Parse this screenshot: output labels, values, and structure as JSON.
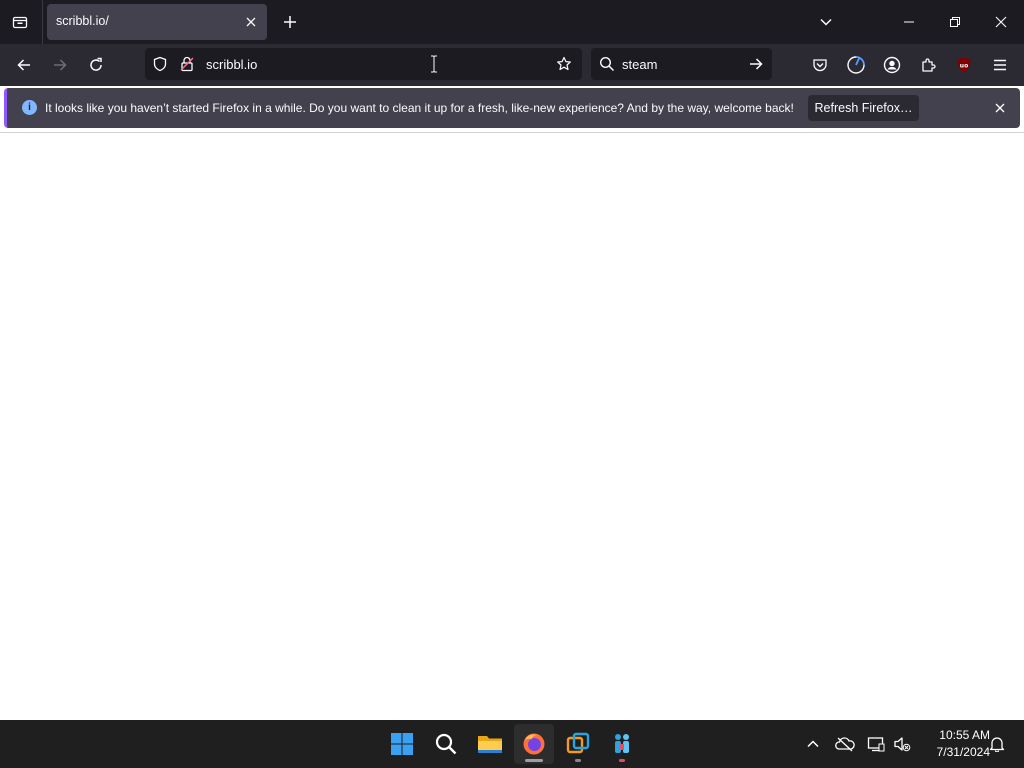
{
  "browser": {
    "tab": {
      "title": "scribbl.io/"
    },
    "url": "scribbl.io",
    "search_value": "steam"
  },
  "notification": {
    "message": "It looks like you haven’t started Firefox in a while. Do you want to clean it up for a fresh, like-new experience? And by the way, welcome back!",
    "button_label": "Refresh Firefox…",
    "accent_color": "#9059ff"
  },
  "taskbar": {
    "apps": [
      "windows-start",
      "search",
      "file-explorer",
      "firefox",
      "vmware",
      "network-app"
    ],
    "clock": {
      "time": "10:55 AM",
      "date": "7/31/2024"
    }
  },
  "colors": {
    "tab_strip": "#1c1b22",
    "toolbar": "#2b2a33",
    "active_tab": "#42414d",
    "taskbar": "#1f1f1f"
  }
}
